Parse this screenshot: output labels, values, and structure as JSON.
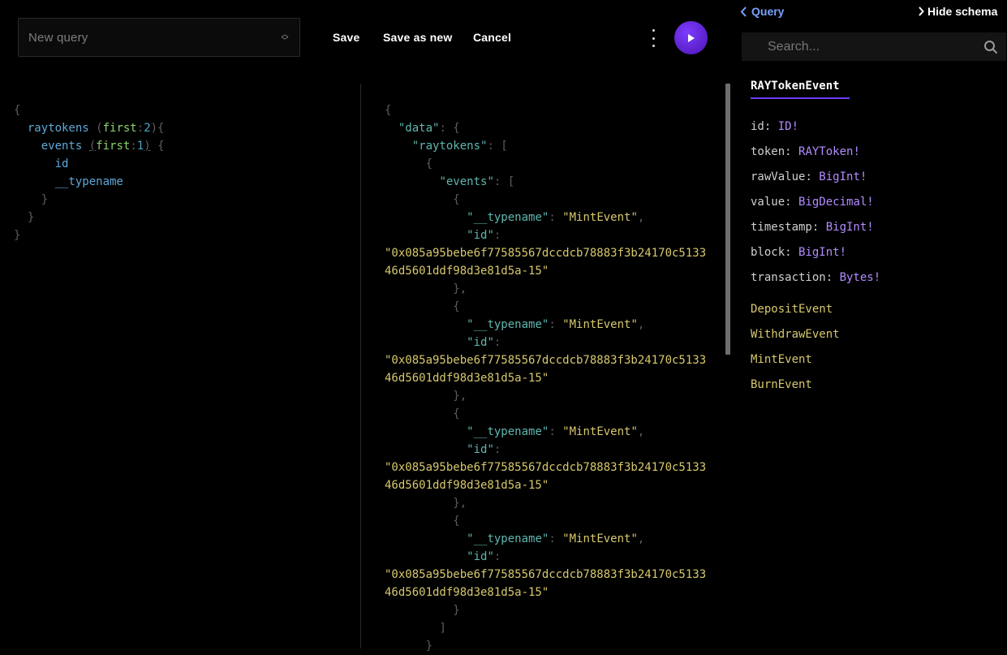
{
  "toolbar": {
    "query_select_placeholder": "New query",
    "save_label": "Save",
    "save_as_new_label": "Save as new",
    "cancel_label": "Cancel",
    "run_icon": "play-icon",
    "more_icon": "vertical-dots-icon",
    "run_color": "#6a2ee8"
  },
  "query_editor": {
    "root_field": "raytokens",
    "root_arg_name": "first",
    "root_arg_value": "2",
    "nested_field": "events",
    "nested_arg_name": "first",
    "nested_arg_value": "1",
    "subfields": [
      "id",
      "__typename"
    ]
  },
  "result": {
    "key_data": "\"data\"",
    "key_raytokens": "\"raytokens\"",
    "key_events": "\"events\"",
    "key_typename": "\"__typename\"",
    "key_id": "\"id\"",
    "events": [
      {
        "typename": "\"MintEvent\"",
        "id_line1": "\"0x085a95bebe6f77585567dccdcb78883f3b24170c5133",
        "id_line2": "46d5601ddf98d3e81d5a-15\""
      },
      {
        "typename": "\"MintEvent\"",
        "id_line1": "\"0x085a95bebe6f77585567dccdcb78883f3b24170c5133",
        "id_line2": "46d5601ddf98d3e81d5a-15\""
      },
      {
        "typename": "\"MintEvent\"",
        "id_line1": "\"0x085a95bebe6f77585567dccdcb78883f3b24170c5133",
        "id_line2": "46d5601ddf98d3e81d5a-15\""
      },
      {
        "typename": "\"MintEvent\"",
        "id_line1": "\"0x085a95bebe6f77585567dccdcb78883f3b24170c5133",
        "id_line2": "46d5601ddf98d3e81d5a-15\""
      }
    ]
  },
  "schema": {
    "back_label": "Query",
    "hide_label": "Hide schema",
    "search_placeholder": "Search...",
    "type_name": "RAYTokenEvent",
    "fields": [
      {
        "name": "id",
        "type": "ID!"
      },
      {
        "name": "token",
        "type": "RAYToken!"
      },
      {
        "name": "rawValue",
        "type": "BigInt!"
      },
      {
        "name": "value",
        "type": "BigDecimal!"
      },
      {
        "name": "timestamp",
        "type": "BigInt!"
      },
      {
        "name": "block",
        "type": "BigInt!"
      },
      {
        "name": "transaction",
        "type": "Bytes!"
      }
    ],
    "implementations": [
      "DepositEvent",
      "WithdrawEvent",
      "MintEvent",
      "BurnEvent"
    ]
  },
  "colors": {
    "accent": "#6c3cff",
    "link": "#7aa2ff",
    "string": "#d7c86d",
    "type": "#b38cff"
  }
}
